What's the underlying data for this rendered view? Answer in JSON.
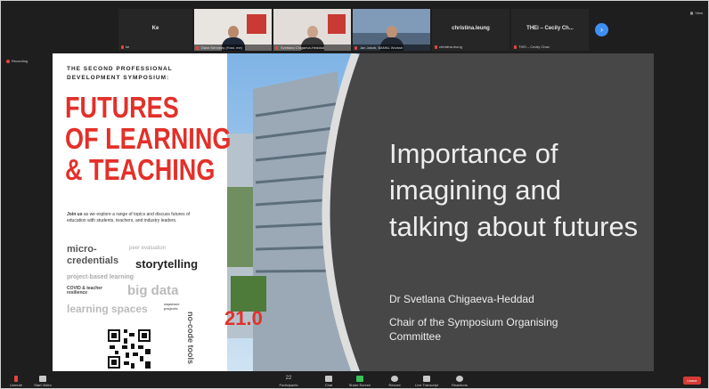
{
  "participants": [
    {
      "name": "Ke",
      "label": "ke"
    },
    {
      "name": "",
      "label": "Dave Kennedy (Host, me)"
    },
    {
      "name": "",
      "label": "Svetlana Chigaeva-Heddad"
    },
    {
      "name": "",
      "label": "Jan Jakob, BANNL Worksh"
    },
    {
      "name": "christina.leung",
      "label": "christina.leung"
    },
    {
      "name": "THEi – Cecily Ch...",
      "label": "THEi – Cecily Chan"
    }
  ],
  "recording": "Recording",
  "top_right": "View",
  "poster": {
    "pre_title": "THE SECOND PROFESSIONAL DEVELOPMENT SYMPOSIUM:",
    "title_lines": [
      "FUTURES",
      "OF LEARNING",
      "& TEACHING"
    ],
    "join_bold": "Join us",
    "join_text": "as we explore a range of topics and discuss futures of education with students, teachers, and industry leaders.",
    "date": "21.0",
    "words": {
      "micro": "micro-",
      "credentials": "credentials",
      "peer": "peer evaluation",
      "storytelling": "storytelling",
      "project": "project-based learning",
      "covid": "COVID & teacher resilience",
      "bigdata": "big data",
      "nocode": "no-code tools",
      "spaces": "learning spaces",
      "capstone": "capstone projects"
    }
  },
  "slide": {
    "title": "Importance of imagining and talking about futures",
    "presenter": "Dr Svetlana Chigaeva-Heddad",
    "role": "Chair of the Symposium Organising Committee"
  },
  "toolbar": {
    "mute": "Unmute",
    "video": "Start Video",
    "participants": "Participants",
    "chat": "Chat",
    "share": "Share Screen",
    "record": "Record",
    "live": "Live Transcript",
    "reactions": "Reactions",
    "leave": "Leave",
    "participant_count": "22"
  },
  "colors": {
    "accent_red": "#e3302a",
    "zoom_blue": "#3f8ef5",
    "share_green": "#3ac25a"
  }
}
